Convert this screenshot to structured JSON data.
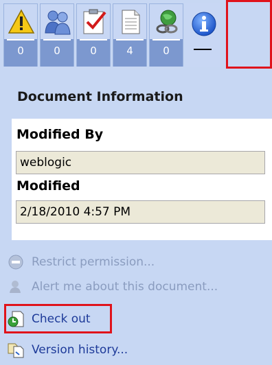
{
  "tabs": [
    {
      "icon": "warning-icon",
      "count": "0"
    },
    {
      "icon": "people-icon",
      "count": "0"
    },
    {
      "icon": "tasks-icon",
      "count": "0"
    },
    {
      "icon": "document-icon",
      "count": "4"
    },
    {
      "icon": "links-icon",
      "count": "0"
    },
    {
      "icon": "info-icon",
      "count": ""
    }
  ],
  "document_info": {
    "title": "Document Information",
    "modified_by_label": "Modified By",
    "modified_by_value": "weblogic",
    "modified_label": "Modified",
    "modified_value": "2/18/2010 4:57 PM"
  },
  "actions": [
    {
      "label": "Restrict permission...",
      "icon": "restrict-icon",
      "enabled": false
    },
    {
      "label": "Alert me about this document...",
      "icon": "alert-icon",
      "enabled": false
    },
    {
      "label": "Check out",
      "icon": "checkout-icon",
      "enabled": true
    },
    {
      "label": "Version history...",
      "icon": "version-history-icon",
      "enabled": true
    }
  ],
  "colors": {
    "panel_bg": "#c7d7f3",
    "highlight": "#e0131b",
    "link": "#1d3a99",
    "disabled": "#8a9cbf"
  }
}
